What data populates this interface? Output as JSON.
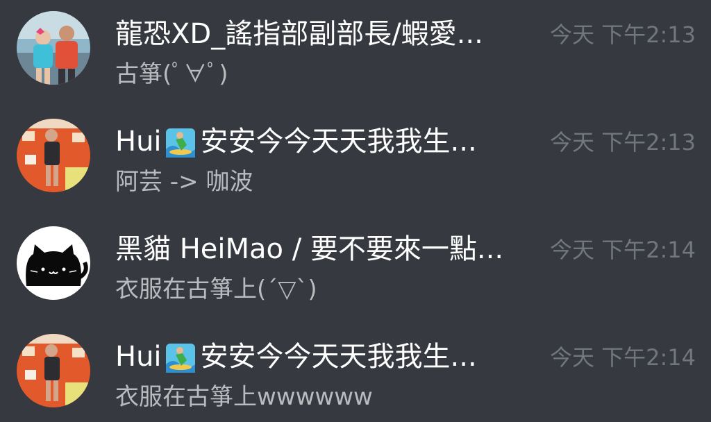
{
  "conversations": [
    {
      "name": "龍恐XD_謠指部副部長/蝦愛...",
      "name_parts": [],
      "preview": "古箏(ﾟ∀ﾟ)",
      "time": "今天 下午2:13",
      "avatar": "avatar-photo-couple"
    },
    {
      "name_parts": [
        "Hui",
        "安安今今天天我我生..."
      ],
      "emoji": "surfer-emoji",
      "preview": "阿芸 -> 咖波",
      "time": "今天 下午2:13",
      "avatar": "avatar-photo-orange-wall"
    },
    {
      "name": "黑貓 HeiMao / 要不要來一點...",
      "preview": "衣服在古箏上(´▽`)",
      "time": "今天 下午2:14",
      "avatar": "avatar-black-cat"
    },
    {
      "name_parts": [
        "Hui",
        "安安今今天天我我生..."
      ],
      "emoji": "surfer-emoji",
      "preview": "衣服在古箏上wwwwww",
      "time": "今天 下午2:14",
      "avatar": "avatar-photo-orange-wall"
    }
  ],
  "colors": {
    "background": "#36393f",
    "title": "#ffffff",
    "preview": "#b9bbbe",
    "time": "#72767d"
  }
}
